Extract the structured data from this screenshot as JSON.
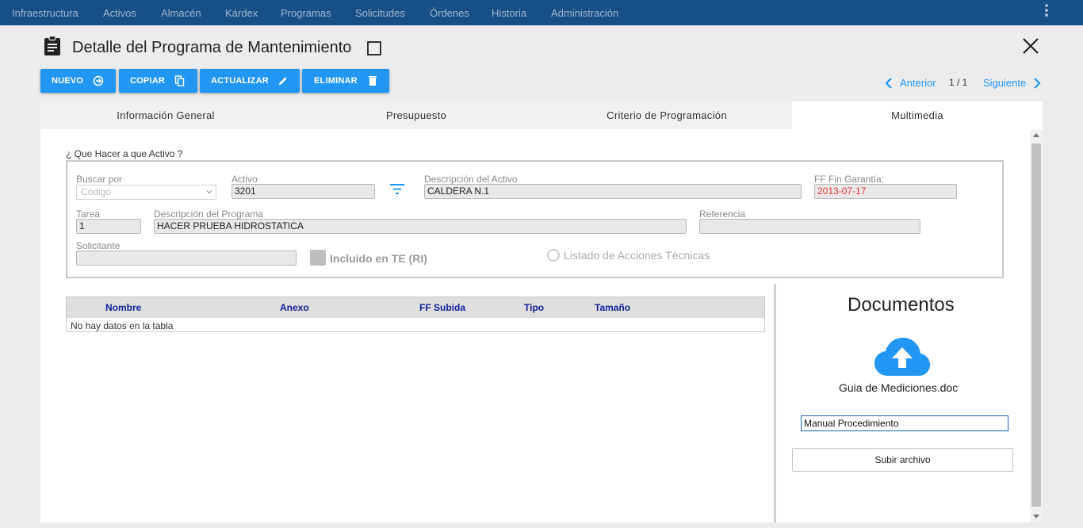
{
  "nav": {
    "items": [
      "Infraestructura",
      "Activos",
      "Almacén",
      "Kárdex",
      "Programas",
      "Solicitudes",
      "Órdenes",
      "Historia",
      "Administración"
    ]
  },
  "header": {
    "title": "Detalle del Programa de Mantenimiento"
  },
  "toolbar": {
    "nuevo": "NUEVO",
    "copiar": "COPIAR",
    "actualizar": "ACTUALIZAR",
    "eliminar": "ELIMINAR"
  },
  "pager": {
    "prev": "Anterior",
    "count": "1 / 1",
    "next": "Siguiente"
  },
  "tabs": [
    "Información General",
    "Presupuesto",
    "Criterio de Programación",
    "Multimedia"
  ],
  "active_tab": "Multimedia",
  "form": {
    "section_label": "¿ Que Hacer a que Activo ?",
    "buscar_por": {
      "label": "Buscar por",
      "placeholder": "Código"
    },
    "activo": {
      "label": "Activo",
      "value": "3201"
    },
    "descripcion_activo": {
      "label": "Descripción del Activo",
      "value": "CALDERA N.1"
    },
    "ff_fin_garantia": {
      "label": "FF Fin Garantía:",
      "value": "2013-07-17",
      "color": "#e53935"
    },
    "tarea": {
      "label": "Tarea",
      "value": "1"
    },
    "descripcion_programa": {
      "label": "Descripción del Programa",
      "value": "HACER PRUEBA HIDROSTATICA"
    },
    "referencia": {
      "label": "Referencia",
      "value": ""
    },
    "solicitante": {
      "label": "Solicitante",
      "value": ""
    },
    "incluido_te": {
      "label": "Incluido en TE (RI)",
      "checked": false
    },
    "listado_acciones": {
      "label": "Listado de Acciones Técnicas",
      "selected": false
    }
  },
  "table": {
    "columns": [
      "Nombre",
      "Anexo",
      "FF Subida",
      "Tipo",
      "Tamaño"
    ],
    "empty_text": "No hay datos en la tabla",
    "rows": []
  },
  "documents": {
    "title": "Documentos",
    "file_name": "Guia de Mediciones.doc",
    "description_value": "Manual Procedimiento",
    "upload_label": "Subir archivo"
  },
  "colors": {
    "nav_bg": "#174f86",
    "accent": "#2196f3",
    "table_header_text": "#12219a",
    "warning_text": "#e53935"
  }
}
